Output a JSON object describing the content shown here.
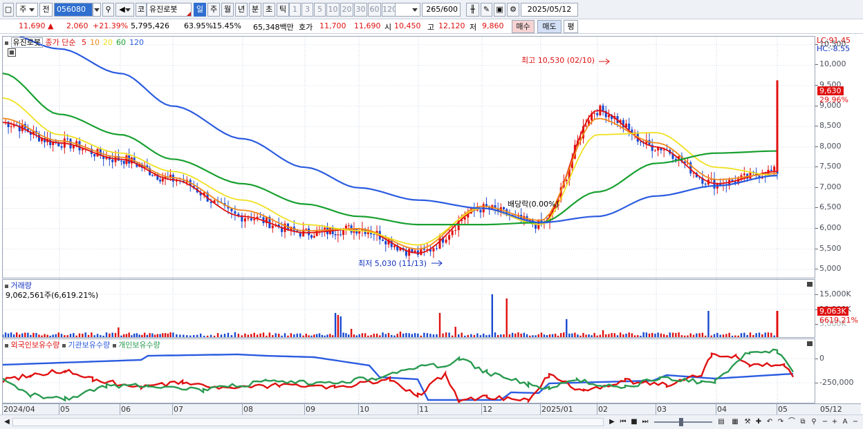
{
  "toolbar": {
    "market_label": "주",
    "kind_label": "전",
    "stock_code": "056080",
    "search_icon": "search-icon",
    "speaker_icon": "speaker-icon",
    "stock_name_prefix": "코",
    "stock_name": "유진로봇",
    "periods": [
      "일",
      "주",
      "월",
      "년",
      "분",
      "초",
      "틱"
    ],
    "selected_period": "일",
    "intervals": [
      "1",
      "3",
      "5",
      "10",
      "20",
      "30",
      "60",
      "120"
    ],
    "count_value": "265",
    "count_max": "/600",
    "date_value": "2025/05/12"
  },
  "quote": {
    "price": "11,690",
    "change": "2,060",
    "change_pct": "+21.39%",
    "volume": "5,795,426",
    "ratio1": "63.95%",
    "ratio2": "15.45%",
    "amount": "65,348백만",
    "hoga_label": "호가",
    "ask": "11,700",
    "bid": "11,690",
    "open_label": "시",
    "open": "10,450",
    "high_label": "고",
    "high": "12,120",
    "low_label": "저",
    "low": "9,860",
    "buy_label": "매수",
    "sell_label": "매도",
    "eval_label": "평"
  },
  "price_pane": {
    "name": "유진로봇",
    "ma_label": "종가 단순",
    "ma_periods": [
      "5",
      "10",
      "20",
      "60",
      "120"
    ],
    "ma_colors": [
      "#e01010",
      "#f08a1a",
      "#f0e020",
      "#18a030",
      "#2a5be0"
    ],
    "lc": "LC:91.45",
    "hc": "HC:-8.55",
    "current_flag": "9,630",
    "current_pct": "29.96%",
    "high_annotation": "최고 10,530 (02/10)",
    "low_annotation": "최저 5,030 (11/13)",
    "dividend_annotation": "배당락(0.00%)",
    "y_ticks": [
      "10,500",
      "10,000",
      "9,500",
      "9,000",
      "8,500",
      "8,000",
      "7,500",
      "7,000",
      "6,500",
      "6,000",
      "5,500",
      "5,000"
    ]
  },
  "volume_pane": {
    "title": "거래량",
    "value": "9,062,561주(6,619.21%)",
    "y_ticks": [
      "15,000K",
      "10,000K"
    ],
    "flag": "9,063K",
    "flag_pct": "6619.21%",
    "hidden_tick": "5,000K"
  },
  "holding_pane": {
    "series": [
      {
        "name": "외국인보유수량",
        "color": "#e01010"
      },
      {
        "name": "기관보유수량",
        "color": "#2a5be0"
      },
      {
        "name": "개인보유수량",
        "color": "#2a9a50"
      }
    ],
    "y_ticks": [
      "0",
      "-250,000"
    ]
  },
  "time_axis": {
    "labels": [
      "2024/04",
      "05",
      "06",
      "07",
      "08",
      "09",
      "10",
      "11",
      "12",
      "2025/01",
      "02",
      "03",
      "04",
      "05"
    ],
    "right_label": "05/12"
  },
  "chart_data": {
    "type": "line",
    "title": "유진로봇",
    "x": [
      "2024/04",
      "05",
      "06",
      "07",
      "08",
      "09",
      "10",
      "11",
      "12",
      "2025/01",
      "02",
      "03",
      "04",
      "05"
    ],
    "ylim": [
      4800,
      10700
    ],
    "series": [
      {
        "name": "5",
        "values": [
          8600,
          8100,
          7700,
          7200,
          6300,
          5900,
          6000,
          5400,
          6500,
          6100,
          8900,
          8000,
          7100,
          7400
        ]
      },
      {
        "name": "10",
        "values": [
          8700,
          8150,
          7750,
          7250,
          6450,
          5950,
          6000,
          5500,
          6550,
          6200,
          8700,
          8100,
          7200,
          7350
        ]
      },
      {
        "name": "20",
        "values": [
          9200,
          8300,
          7850,
          7400,
          6700,
          6100,
          5950,
          5600,
          6500,
          6100,
          8300,
          8350,
          7500,
          7300
        ]
      },
      {
        "name": "60",
        "values": [
          9800,
          8800,
          8300,
          7700,
          7100,
          6600,
          6300,
          6100,
          6100,
          6150,
          6900,
          7600,
          7850,
          7900
        ]
      },
      {
        "name": "120",
        "values": [
          10800,
          10400,
          9800,
          9000,
          8200,
          7500,
          7000,
          6700,
          6500,
          6150,
          6300,
          6800,
          7050,
          7300
        ]
      }
    ]
  }
}
